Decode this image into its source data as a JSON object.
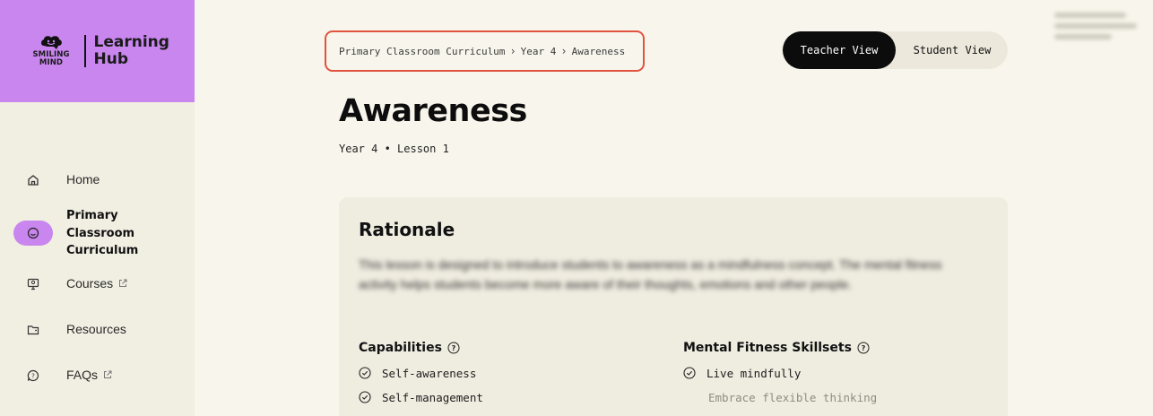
{
  "brand": {
    "logo_line1": "SMILING",
    "logo_line2": "MIND",
    "title_line1": "Learning",
    "title_line2": "Hub",
    "accent_color": "#c886ee"
  },
  "sidebar": {
    "items": [
      {
        "label": "Home",
        "icon": "home-icon"
      },
      {
        "label": "Primary Classroom Curriculum",
        "icon": "smiley-icon",
        "active": true
      },
      {
        "label": "Courses",
        "icon": "monitor-icon",
        "external": true
      },
      {
        "label": "Resources",
        "icon": "folder-icon"
      },
      {
        "label": "FAQs",
        "icon": "question-chat-icon",
        "external": true
      }
    ]
  },
  "breadcrumb": {
    "items": [
      "Primary Classroom Curriculum",
      "Year 4",
      "Awareness"
    ],
    "highlight_color": "#e0533f"
  },
  "view_toggle": {
    "teacher": "Teacher View",
    "student": "Student View",
    "selected": "Teacher View"
  },
  "page": {
    "title": "Awareness",
    "subtitle": "Year 4 • Lesson 1"
  },
  "rationale": {
    "title": "Rationale",
    "text": "This lesson is designed to introduce students to awareness as a mindfulness concept. The mental fitness activity helps students become more aware of their thoughts, emotions and other people."
  },
  "capabilities": {
    "title": "Capabilities",
    "items": [
      "Self-awareness",
      "Self-management"
    ]
  },
  "skillsets": {
    "title": "Mental Fitness Skillsets",
    "items": [
      {
        "label": "Live mindfully",
        "checked": true
      },
      {
        "label": "Embrace flexible thinking",
        "checked": false
      }
    ]
  }
}
